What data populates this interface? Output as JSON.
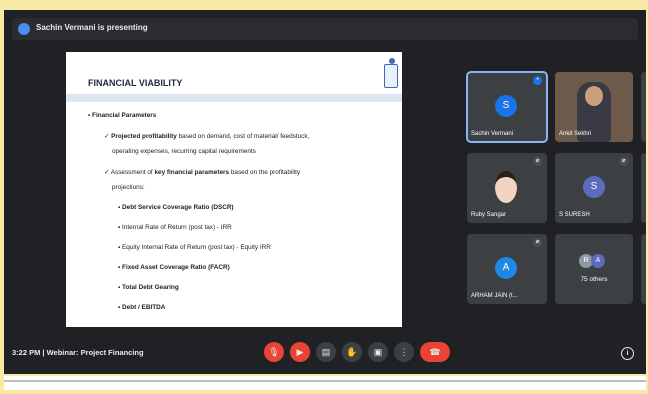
{
  "presenting": {
    "text": "Sachin Vermani is presenting"
  },
  "slide": {
    "title": "FINANCIAL VIABILITY",
    "heading": "Financial Parameters",
    "bullet1_bold": "Projected profitability",
    "bullet1_rest": " based on demand, cost of material/ feedstock,",
    "bullet1_line2": "operating expenses, recurring capital requirements",
    "bullet2_pre": "Assessment of ",
    "bullet2_bold": "key financial parameters",
    "bullet2_rest": " based on the profitability",
    "bullet2_line2": "projections:",
    "items": [
      {
        "text": "Debt Service Coverage Ratio (DSCR)",
        "bold": true
      },
      {
        "text": "Internal Rate of Return (post tax) - IRR",
        "bold": false
      },
      {
        "text": "Equity Internal Rate of Return (post tax) - Equity IRR",
        "bold": false
      },
      {
        "text": "Fixed Asset Coverage Ratio (FACR)",
        "bold": true
      },
      {
        "text": "Total Debt Gearing",
        "bold": true
      },
      {
        "text": "Debt / EBITDA",
        "bold": true
      }
    ]
  },
  "participants": {
    "tile1": {
      "name": "Sachin Vermani",
      "initial": "S",
      "color": "#1a73e8"
    },
    "tile2": {
      "name": "Ankit Sekhri"
    },
    "tile4": {
      "name": "Ruby Sangar"
    },
    "tile5": {
      "name": "S SURESH",
      "initial": "S",
      "color": "#5c6bc0"
    },
    "tile7": {
      "name": "ARHAM JAIN (t...",
      "initial": "A",
      "color": "#1e88e5"
    },
    "tile8": {
      "name": "75 others",
      "initial1": "R",
      "initial2": "A"
    }
  },
  "bottombar": {
    "time_meeting": "3:22 PM  |  Webinar: Project Financing"
  },
  "icons": [
    "presenting-icon",
    "mic-off-icon",
    "camera-off-icon",
    "captions-icon",
    "raise-hand-icon",
    "present-screen-icon",
    "more-options-icon",
    "leave-call-icon",
    "info-icon"
  ]
}
